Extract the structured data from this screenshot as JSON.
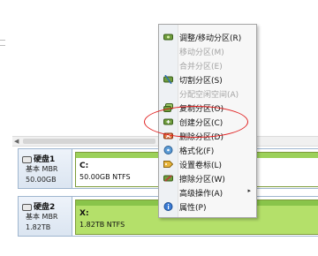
{
  "context_menu": {
    "items": [
      {
        "label": "调整/移动分区(R)",
        "icon": "resize-partition-icon",
        "enabled": true,
        "submenu": false
      },
      {
        "label": "移动分区(M)",
        "icon": "",
        "enabled": false,
        "submenu": false
      },
      {
        "label": "合并分区(E)",
        "icon": "",
        "enabled": false,
        "submenu": false
      },
      {
        "label": "切割分区(S)",
        "icon": "split-partition-icon",
        "enabled": true,
        "submenu": false
      },
      {
        "label": "分配空闲空间(A)",
        "icon": "",
        "enabled": false,
        "submenu": false
      },
      {
        "label": "复制分区(O)",
        "icon": "copy-partition-icon",
        "enabled": true,
        "submenu": false
      },
      {
        "label": "创建分区(C)",
        "icon": "create-partition-icon",
        "enabled": true,
        "submenu": false
      },
      {
        "label": "删除分区(D)",
        "icon": "delete-partition-icon",
        "enabled": true,
        "submenu": false
      },
      {
        "label": "格式化(F)",
        "icon": "format-icon",
        "enabled": true,
        "submenu": false
      },
      {
        "label": "设置卷标(L)",
        "icon": "label-icon",
        "enabled": true,
        "submenu": false
      },
      {
        "label": "擦除分区(W)",
        "icon": "wipe-partition-icon",
        "enabled": true,
        "submenu": false
      },
      {
        "label": "高级操作(A)",
        "icon": "",
        "enabled": true,
        "submenu": true
      },
      {
        "label": "属性(P)",
        "icon": "properties-icon",
        "enabled": true,
        "submenu": false
      }
    ],
    "submenu_arrow": "▸"
  },
  "disks": [
    {
      "name": "硬盘1",
      "type": "基本 MBR",
      "size": "50.00GB",
      "partition": {
        "letter": "C:",
        "desc": "50.00GB NTFS"
      }
    },
    {
      "name": "硬盘2",
      "type": "基本 MBR",
      "size": "1.82TB",
      "partition": {
        "letter": "X:",
        "desc": "1.82TB NTFS"
      }
    }
  ],
  "colors": {
    "partition_fill": "#b4e06a",
    "highlight": "#e02020",
    "menu_bg": "#f7f7f7"
  }
}
